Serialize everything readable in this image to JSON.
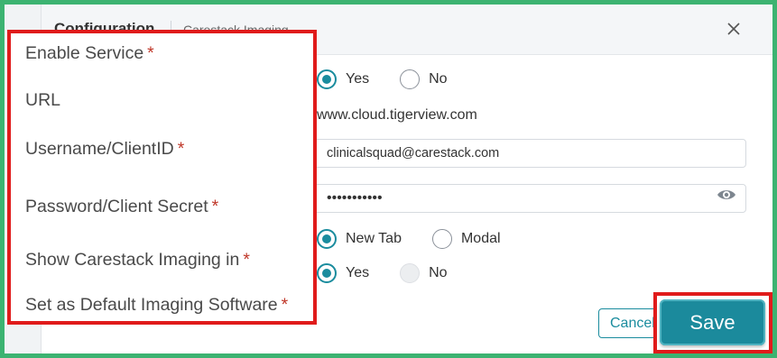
{
  "modal": {
    "title": "Configuration",
    "subtitle": "Carestack Imaging",
    "close_icon": "close-icon"
  },
  "fields": {
    "enable_service": {
      "label": "Enable Service",
      "required_mark": "*",
      "options": [
        "Yes",
        "No"
      ],
      "selected": "Yes"
    },
    "url": {
      "label": "URL",
      "value": "www.cloud.tigerview.com"
    },
    "username": {
      "label": "Username/ClientID",
      "required_mark": "*",
      "value": "clinicalsquad@carestack.com"
    },
    "password": {
      "label": "Password/Client Secret",
      "required_mark": "*",
      "value": "•••••••••••",
      "toggle_icon": "eye-icon"
    },
    "show_in": {
      "label": "Show Carestack Imaging in",
      "required_mark": "*",
      "options": [
        "New Tab",
        "Modal"
      ],
      "selected": "New Tab"
    },
    "default_software": {
      "label": "Set as Default Imaging Software",
      "required_mark": "*",
      "options": [
        "Yes",
        "No"
      ],
      "selected": "Yes",
      "disabled_option": "No"
    }
  },
  "footer": {
    "cancel_label": "Cancel",
    "save_label": "Save"
  },
  "colors": {
    "accent": "#1a8c9e",
    "highlight_border": "#e01b1b",
    "page_border": "#3cb371",
    "required": "#c0392b"
  }
}
